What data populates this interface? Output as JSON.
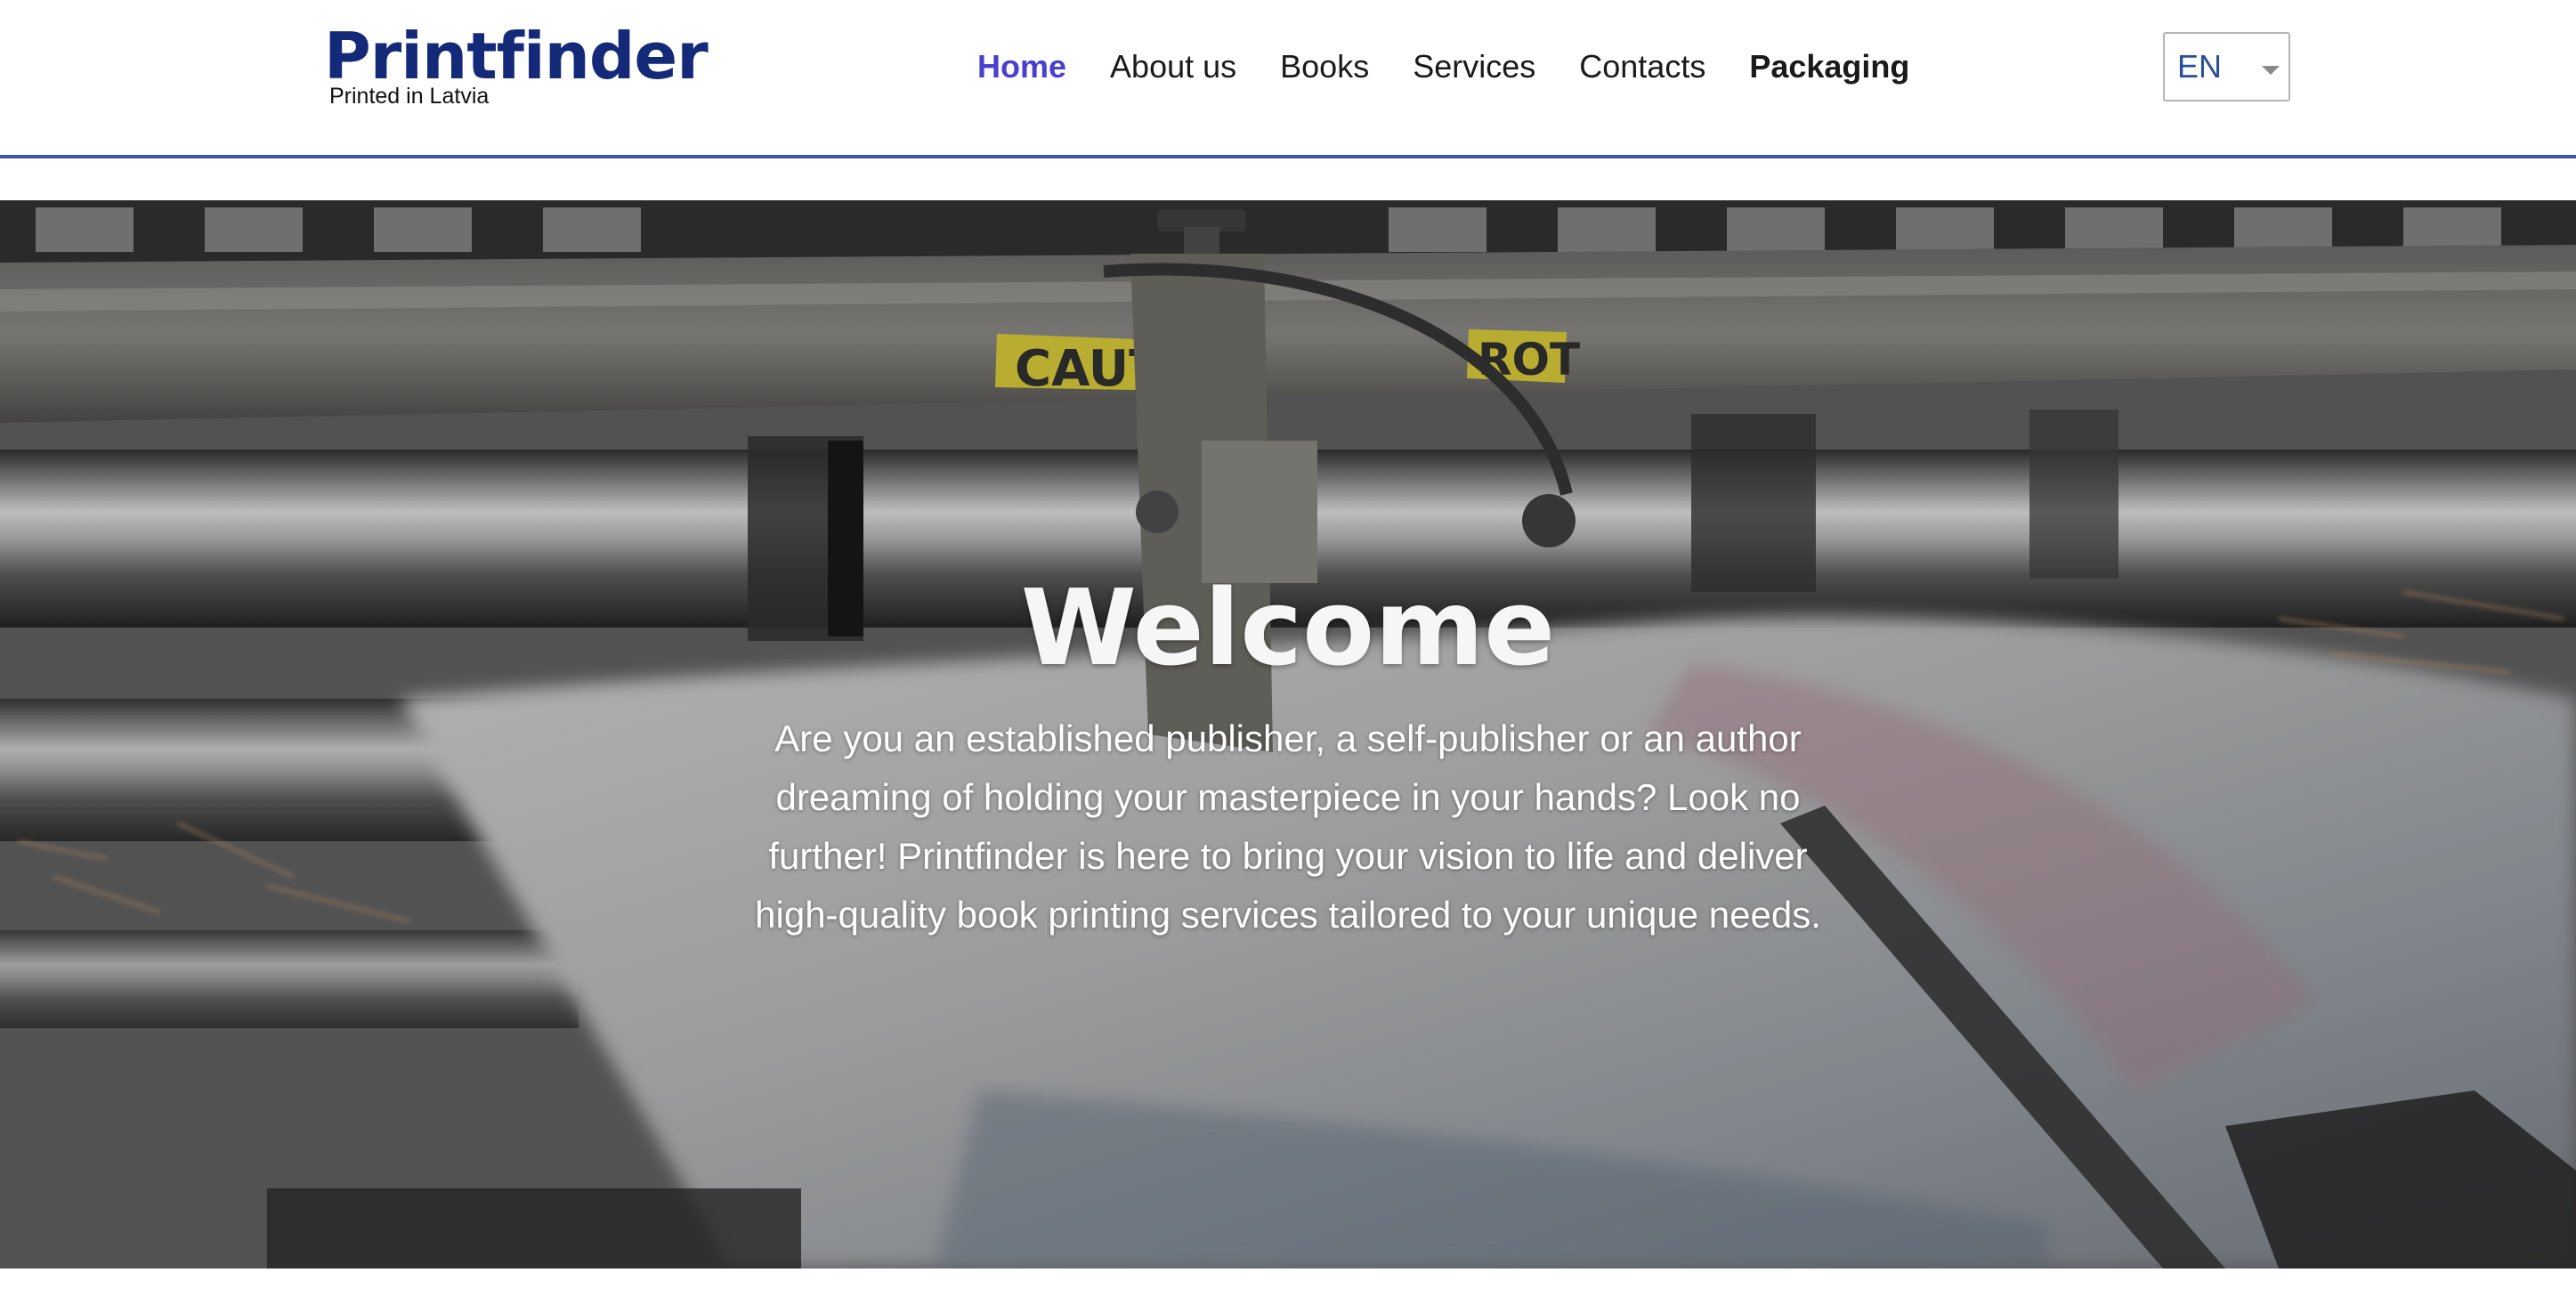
{
  "brand": {
    "name": "Printfinder",
    "tagline": "Printed in Latvia"
  },
  "nav": {
    "items": [
      {
        "label": "Home",
        "active": true
      },
      {
        "label": "About us"
      },
      {
        "label": "Books"
      },
      {
        "label": "Services"
      },
      {
        "label": "Contacts"
      },
      {
        "label": "Packaging",
        "emphasis": "bold"
      }
    ]
  },
  "language": {
    "selected": "EN"
  },
  "hero": {
    "title": "Welcome",
    "text": "Are you an established publisher, a self-publisher or an author dreaming of holding your masterpiece in your hands? Look no further! Printfinder is here to bring your vision to life and deliver high-quality book printing services tailored to your unique needs.",
    "caution_label_1": "CAUTIO",
    "caution_label_2": "ROT"
  },
  "colors": {
    "brand": "#142a78",
    "nav_active": "#4a3fcf",
    "header_rule": "#3e55a7",
    "language_text": "#2a4f9a",
    "caution_label": "#e2d234"
  }
}
